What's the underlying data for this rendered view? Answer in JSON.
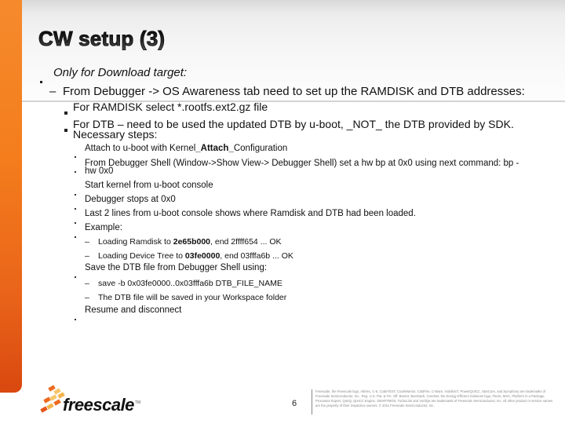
{
  "slide": {
    "title": "CW setup (3)",
    "page_number": "6",
    "accent_color": "#f47d1c"
  },
  "content": {
    "l1": {
      "text": "Only for Download target:",
      "marker": "•"
    },
    "l2": {
      "text": "From Debugger -> OS Awareness tab need to set up the RAMDISK and DTB addresses:",
      "marker": "–"
    },
    "l3": [
      {
        "text": "For RAMDISK select *.rootfs.ext2.gz file"
      },
      {
        "text_line1": "For DTB – need to be used the updated DTB by u-boot, _NOT_ the DTB provided by SDK.",
        "text_line2": "Necessary steps:"
      }
    ],
    "steps": [
      {
        "pre": "Attach to u-boot with Kernel",
        "bold": "_Attach_",
        "post": "Configuration"
      },
      {
        "line1": "From Debugger Shell (Window->Show View-> Debugger Shell) set a hw bp at 0x0 using next command: bp -",
        "line2": "hw 0x0"
      },
      {
        "text": "Start kernel from u-boot console"
      },
      {
        "text": "Debugger stops at 0x0"
      },
      {
        "text": "Last 2 lines from u-boot console shows where Ramdisk and DTB had been loaded."
      },
      {
        "text": "Example:"
      },
      {
        "text": "Save the DTB file from Debugger Shell using:"
      },
      {
        "text": "Resume and disconnect"
      }
    ],
    "example_lines": [
      {
        "pre": "Loading Ramdisk to ",
        "bold": "2e65b000",
        "post": ", end 2ffff654 ... OK"
      },
      {
        "pre": "Loading Device Tree to ",
        "bold": "03fe0000",
        "post": ", end 03fffa6b ... OK"
      }
    ],
    "save_lines": [
      {
        "text": "save -b 0x03fe0000..0x03fffa6b DTB_FILE_NAME"
      },
      {
        "text": "The  DTB file will be saved in your Workspace folder"
      }
    ]
  },
  "footer": {
    "logo_text": "freescale",
    "logo_tm": "TM",
    "logo_icon": "freescale-chevron-icon",
    "legal_text": "Freescale, the Freescale logo, AltiVec, C-5, CodeTEST, CodeWarrior, ColdFire, C-Ware, mobileGT, PowerQUICC, StarCore, and Symphony are trademarks of Freescale Semiconductor, Inc., Reg. U.S. Pat. & Tm. Off. BeeKit, BeeStack, CoreNet, the Energy Efficient Solutions logo, Flexis, MXC, Platform in a Package, Processor Expert, QorIQ, QUICC Engine, SMARTMOS, TurboLink and VortiQa are trademarks of Freescale Semiconductor, Inc. All other product or service names are the property of their respective owners. © 2011 Freescale Semiconductor, Inc."
  }
}
